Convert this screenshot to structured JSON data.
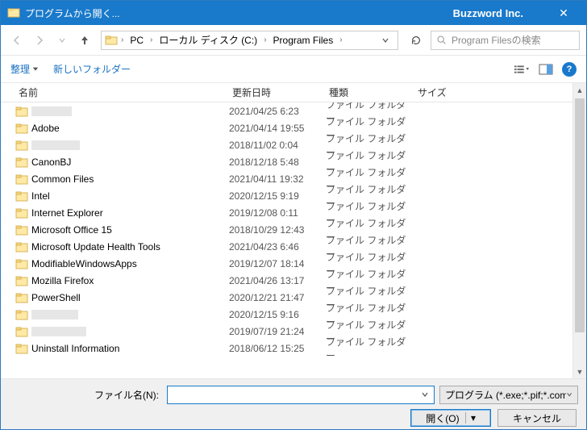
{
  "titlebar": {
    "title": "プログラムから開く...",
    "brand": "Buzzword Inc."
  },
  "breadcrumb": {
    "pc": "PC",
    "disk": "ローカル ディスク (C:)",
    "folder": "Program Files"
  },
  "search": {
    "placeholder": "Program Filesの検索"
  },
  "toolbar": {
    "organize": "整理",
    "newfolder": "新しいフォルダー"
  },
  "columns": {
    "name": "名前",
    "date": "更新日時",
    "type": "種類",
    "size": "サイズ"
  },
  "typestr": "ファイル フォルダー",
  "files": [
    {
      "name": "",
      "redacted": true,
      "rw": 50,
      "date": "2021/04/25 6:23"
    },
    {
      "name": "Adobe",
      "date": "2021/04/14 19:55"
    },
    {
      "name": "",
      "redacted": true,
      "rw": 60,
      "date": "2018/11/02 0:04"
    },
    {
      "name": "CanonBJ",
      "date": "2018/12/18 5:48"
    },
    {
      "name": "Common Files",
      "date": "2021/04/11 19:32"
    },
    {
      "name": "Intel",
      "date": "2020/12/15 9:19"
    },
    {
      "name": "Internet Explorer",
      "date": "2019/12/08 0:11"
    },
    {
      "name": "Microsoft Office 15",
      "date": "2018/10/29 12:43"
    },
    {
      "name": "Microsoft Update Health Tools",
      "date": "2021/04/23 6:46"
    },
    {
      "name": "ModifiableWindowsApps",
      "date": "2019/12/07 18:14"
    },
    {
      "name": "Mozilla Firefox",
      "date": "2021/04/26 13:17"
    },
    {
      "name": "PowerShell",
      "date": "2020/12/21 21:47"
    },
    {
      "name": "",
      "redacted": true,
      "rw": 58,
      "date": "2020/12/15 9:16"
    },
    {
      "name": "",
      "redacted": true,
      "rw": 68,
      "date": "2019/07/19 21:24"
    },
    {
      "name": "Uninstall Information",
      "date": "2018/06/12 15:25"
    }
  ],
  "footer": {
    "filename_label": "ファイル名(N):",
    "filter": "プログラム (*.exe;*.pif;*.com;*.bat",
    "open": "開く(O)",
    "cancel": "キャンセル"
  }
}
